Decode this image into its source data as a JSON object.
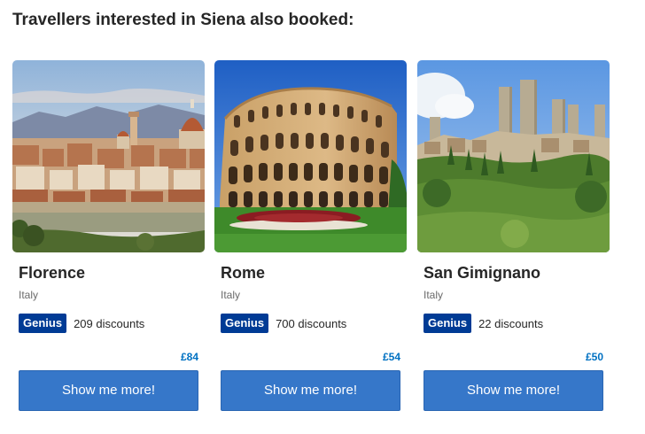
{
  "heading": "Travellers interested in Siena also booked:",
  "cards": [
    {
      "city": "Florence",
      "country": "Italy",
      "genius_label": "Genius",
      "discounts": "209 discounts",
      "price": "£84",
      "button_label": "Show me more!",
      "photo_icon": "florence-cityscape-photo"
    },
    {
      "city": "Rome",
      "country": "Italy",
      "genius_label": "Genius",
      "discounts": "700 discounts",
      "price": "£54",
      "button_label": "Show me more!",
      "photo_icon": "colosseum-photo"
    },
    {
      "city": "San Gimignano",
      "country": "Italy",
      "genius_label": "Genius",
      "discounts": "22 discounts",
      "price": "£50",
      "button_label": "Show me more!",
      "photo_icon": "san-gimignano-towers-photo"
    }
  ],
  "colors": {
    "genius_badge": "#003b95",
    "button": "#3677c9",
    "price": "#0071c2"
  }
}
